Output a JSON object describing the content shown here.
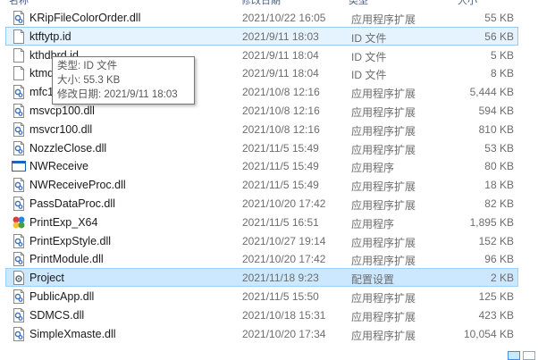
{
  "columns": {
    "name": "名称",
    "date": "修改日期",
    "type": "类型",
    "size": "大小"
  },
  "files": [
    {
      "name": "KRipFileColorOrder.dll",
      "date": "2021/10/22 16:05",
      "type": "应用程序扩展",
      "size": "55 KB",
      "icon": "dll-icon"
    },
    {
      "name": "ktftytp.id",
      "date": "2021/9/11 18:03",
      "type": "ID 文件",
      "size": "56 KB",
      "icon": "file-icon"
    },
    {
      "name": "kthdbrd.id",
      "date": "2021/9/11 18:04",
      "type": "ID 文件",
      "size": "5 KB",
      "icon": "file-icon"
    },
    {
      "name": "ktmd",
      "date": "2021/9/11 18:04",
      "type": "ID 文件",
      "size": "8 KB",
      "icon": "file-icon"
    },
    {
      "name": "mfc1",
      "date": "2021/10/8 12:16",
      "type": "应用程序扩展",
      "size": "5,444 KB",
      "icon": "dll-icon"
    },
    {
      "name": "msvcp100.dll",
      "date": "2021/10/8 12:16",
      "type": "应用程序扩展",
      "size": "594 KB",
      "icon": "dll-icon"
    },
    {
      "name": "msvcr100.dll",
      "date": "2021/10/8 12:16",
      "type": "应用程序扩展",
      "size": "810 KB",
      "icon": "dll-icon"
    },
    {
      "name": "NozzleClose.dll",
      "date": "2021/11/5 15:49",
      "type": "应用程序扩展",
      "size": "53 KB",
      "icon": "dll-icon"
    },
    {
      "name": "NWReceive",
      "date": "2021/11/5 15:49",
      "type": "应用程序",
      "size": "80 KB",
      "icon": "exe-icon"
    },
    {
      "name": "NWReceiveProc.dll",
      "date": "2021/11/5 15:49",
      "type": "应用程序扩展",
      "size": "18 KB",
      "icon": "dll-icon"
    },
    {
      "name": "PassDataProc.dll",
      "date": "2021/10/20 17:42",
      "type": "应用程序扩展",
      "size": "82 KB",
      "icon": "dll-icon"
    },
    {
      "name": "PrintExp_X64",
      "date": "2021/11/5 16:51",
      "type": "应用程序",
      "size": "1,895 KB",
      "icon": "app-color-icon"
    },
    {
      "name": "PrintExpStyle.dll",
      "date": "2021/10/27 19:14",
      "type": "应用程序扩展",
      "size": "152 KB",
      "icon": "dll-icon"
    },
    {
      "name": "PrintModule.dll",
      "date": "2021/10/20 17:42",
      "type": "应用程序扩展",
      "size": "96 KB",
      "icon": "dll-icon"
    },
    {
      "name": "Project",
      "date": "2021/11/18 9:23",
      "type": "配置设置",
      "size": "2 KB",
      "icon": "config-icon"
    },
    {
      "name": "PublicApp.dll",
      "date": "2021/11/5 15:50",
      "type": "应用程序扩展",
      "size": "125 KB",
      "icon": "dll-icon"
    },
    {
      "name": "SDMCS.dll",
      "date": "2021/10/18 15:31",
      "type": "应用程序扩展",
      "size": "423 KB",
      "icon": "dll-icon"
    },
    {
      "name": "SimpleXmaste.dll",
      "date": "2021/10/20 17:34",
      "type": "应用程序扩展",
      "size": "10,054 KB",
      "icon": "dll-icon"
    }
  ],
  "tooltip": {
    "type_line": "类型: ID 文件",
    "size_line": "大小: 55.3 KB",
    "date_line": "修改日期: 2021/9/11 18:03"
  }
}
